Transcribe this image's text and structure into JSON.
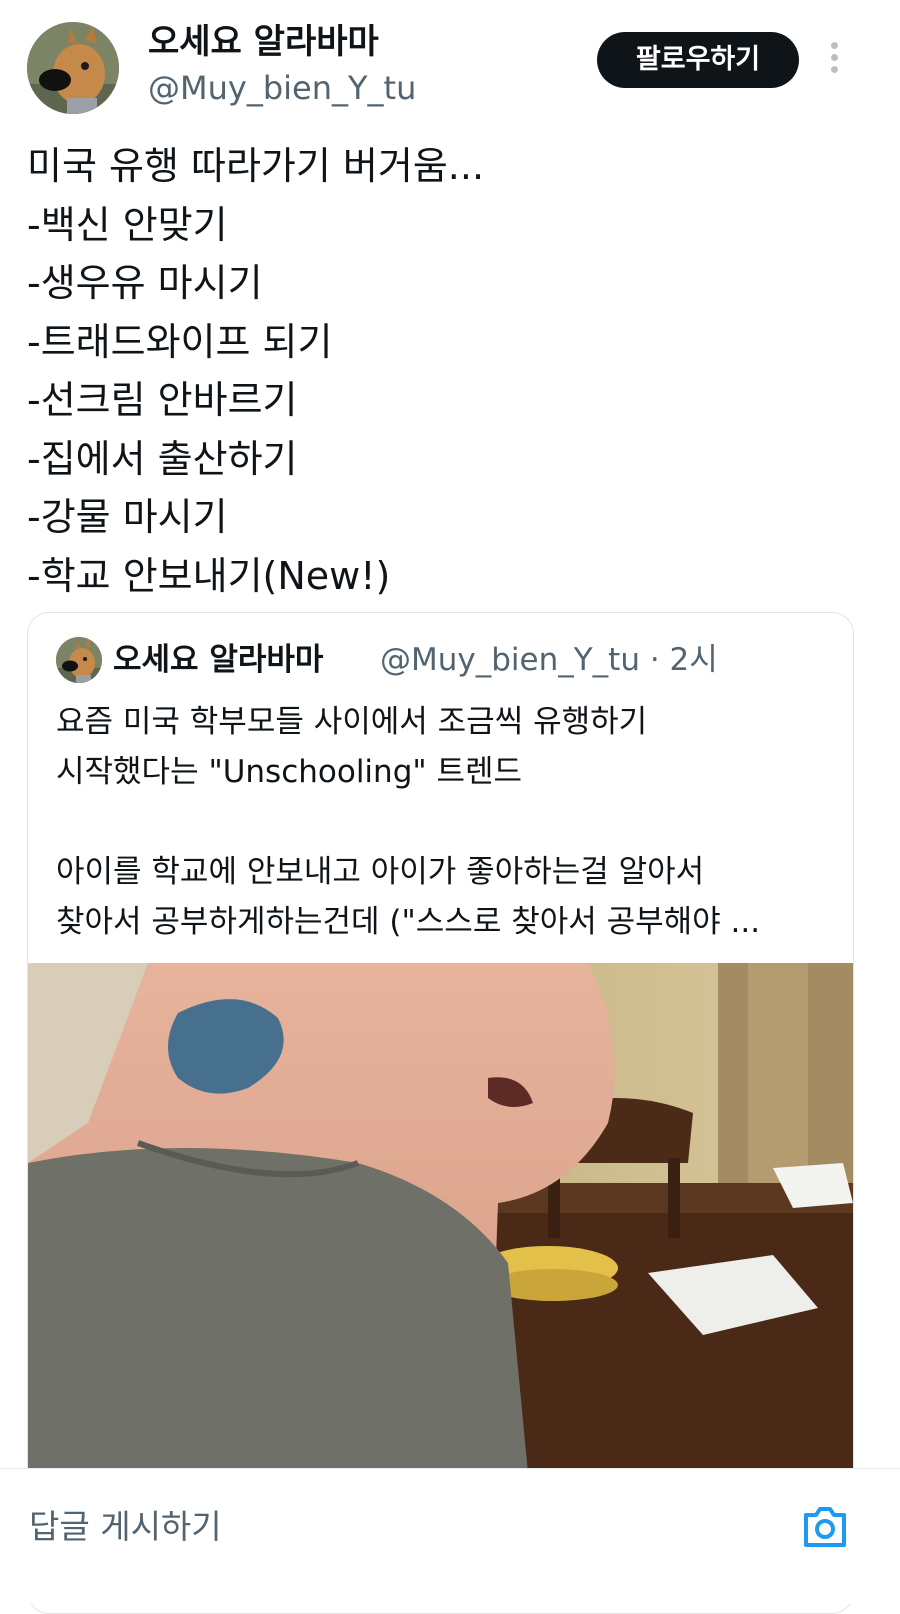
{
  "author": {
    "display_name": "오세요 알라바마",
    "handle": "@Muy_bien_Y_tu",
    "avatar_icon": "dog-avatar-icon"
  },
  "actions": {
    "follow_label": "팔로우하기",
    "more_icon": "more-vertical-icon"
  },
  "tweet": {
    "lines": [
      "미국 유행 따라가기 버거움...",
      "-백신 안맞기",
      "-생우유 마시기",
      "-트래드와이프 되기",
      "-선크림 안바르기",
      "-집에서 출산하기",
      "-강물 마시기",
      "-학교 안보내기(New!)"
    ]
  },
  "quoted_tweet": {
    "display_name": "오세요 알라바마",
    "handle": "@Muy_bien_Y_tu",
    "time_meta": "@Muy_bien_Y_tu · 2시",
    "lines": [
      "요즘 미국 학부모들 사이에서 조금씩 유행하기",
      "시작했다는 \"Unschooling\" 트렌드",
      "",
      "아이를 학교에 안보내고 아이가 좋아하는걸 알아서",
      "찾아서 공부하게하는건데 (\"스스로 찾아서 공부해야 ..."
    ],
    "media_icon": "video-thumbnail"
  },
  "reply": {
    "placeholder": "답글 게시하기",
    "camera_icon": "camera-icon"
  },
  "colors": {
    "text": "#0f1419",
    "secondary": "#536471",
    "follow_bg": "#0f1419",
    "accent": "#1d9bf0",
    "border": "#dfe3e7"
  }
}
